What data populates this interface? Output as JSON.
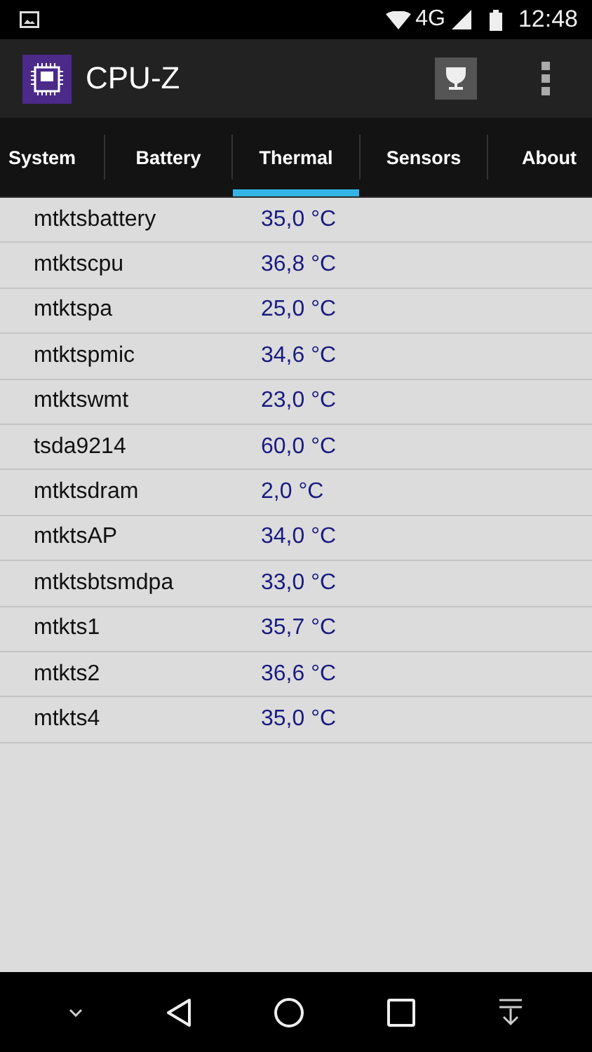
{
  "status_bar": {
    "network": "4G",
    "time": "12:48"
  },
  "app_bar": {
    "title": "CPU-Z"
  },
  "tabs": [
    {
      "label": "System",
      "selected": false
    },
    {
      "label": "Battery",
      "selected": false
    },
    {
      "label": "Thermal",
      "selected": true
    },
    {
      "label": "Sensors",
      "selected": false
    },
    {
      "label": "About",
      "selected": false
    }
  ],
  "sensors": [
    {
      "name": "mtktsbattery",
      "value": "35,0 °C"
    },
    {
      "name": "mtktscpu",
      "value": "36,8 °C"
    },
    {
      "name": "mtktspa",
      "value": "25,0 °C"
    },
    {
      "name": "mtktspmic",
      "value": "34,6 °C"
    },
    {
      "name": "mtktswmt",
      "value": "23,0 °C"
    },
    {
      "name": "tsda9214",
      "value": "60,0 °C"
    },
    {
      "name": "mtktsdram",
      "value": "2,0 °C"
    },
    {
      "name": "mtktsAP",
      "value": "34,0 °C"
    },
    {
      "name": "mtktsbtsmdpa",
      "value": "33,0 °C"
    },
    {
      "name": "mtkts1",
      "value": "35,7 °C"
    },
    {
      "name": "mtkts2",
      "value": "36,6 °C"
    },
    {
      "name": "mtkts4",
      "value": "35,0 °C"
    }
  ]
}
